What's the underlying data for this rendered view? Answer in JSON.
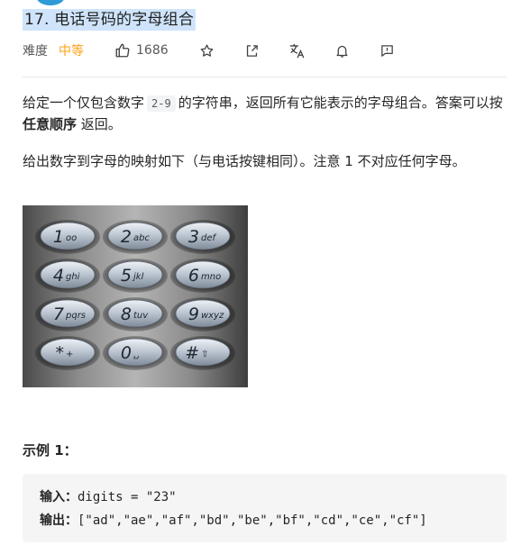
{
  "problem": {
    "title": "17. 电话号码的字母组合",
    "difficulty_label": "难度",
    "difficulty_value": "中等",
    "likes": "1686"
  },
  "icons": {
    "like": "thumbs-up-icon",
    "favorite": "star-icon",
    "share": "share-icon",
    "translate": "translate-icon",
    "notify": "bell-icon",
    "feedback": "feedback-icon"
  },
  "description": {
    "p1_before": "给定一个仅包含数字",
    "p1_code": "2-9",
    "p1_middle": "的字符串，返回所有它能表示的字母组合。答案可以按",
    "p1_bold": "任意顺序",
    "p1_after": "返回。",
    "p2": "给出数字到字母的映射如下（与电话按键相同）。注意 1 不对应任何字母。"
  },
  "keypad": {
    "keys": [
      {
        "digit": "1",
        "sub": "oo"
      },
      {
        "digit": "2",
        "sub": "abc"
      },
      {
        "digit": "3",
        "sub": "def"
      },
      {
        "digit": "4",
        "sub": "ghi"
      },
      {
        "digit": "5",
        "sub": "jkl"
      },
      {
        "digit": "6",
        "sub": "mno"
      },
      {
        "digit": "7",
        "sub": "pqrs"
      },
      {
        "digit": "8",
        "sub": "tuv"
      },
      {
        "digit": "9",
        "sub": "wxyz"
      },
      {
        "digit": "*",
        "sub": "+"
      },
      {
        "digit": "0",
        "sub": "␣"
      },
      {
        "digit": "#",
        "sub": "⇧"
      }
    ]
  },
  "example": {
    "title": "示例 1：",
    "input_label": "输入：",
    "input_value": "digits = \"23\"",
    "output_label": "输出：",
    "output_value": "[\"ad\",\"ae\",\"af\",\"bd\",\"be\",\"bf\",\"cd\",\"ce\",\"cf\"]"
  },
  "colors": {
    "medium_difficulty": "#ffa116",
    "title_highlight": "#cfe4fb"
  }
}
